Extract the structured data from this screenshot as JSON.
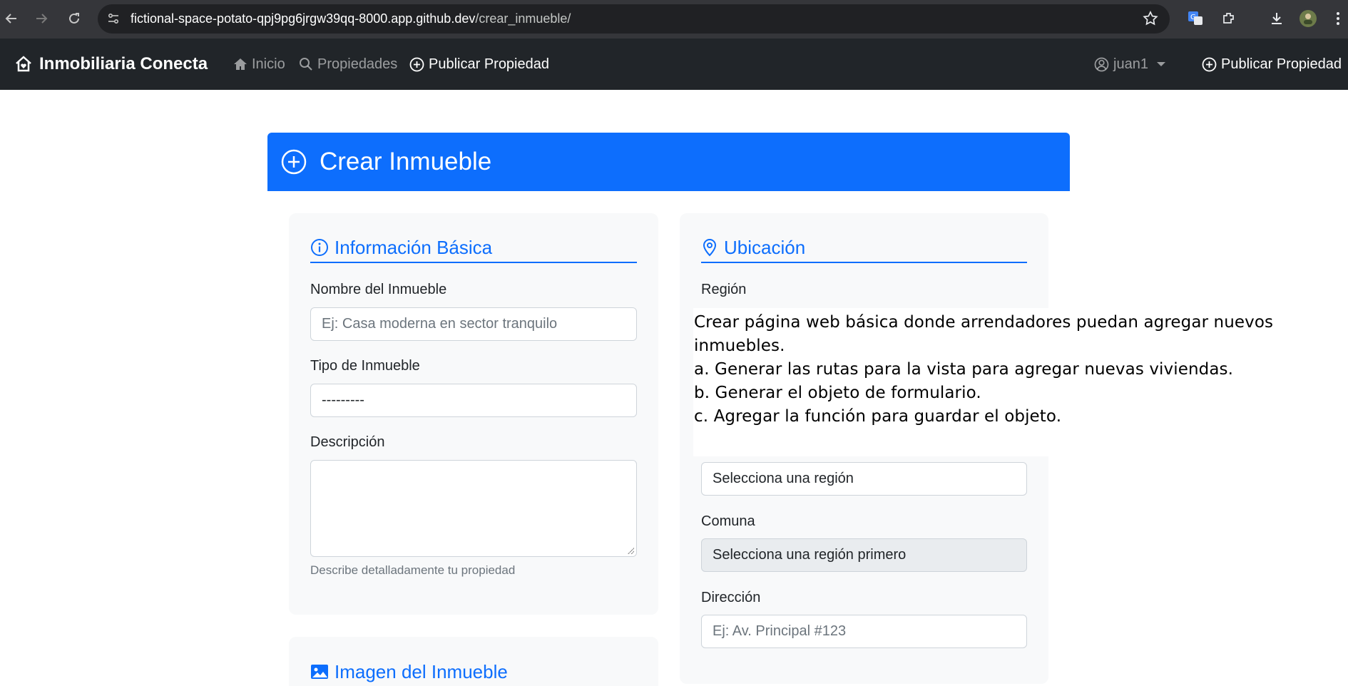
{
  "browser": {
    "url_host": "fictional-space-potato-qpj9pg6jrgw39qq-8000.app.github.dev",
    "url_path": "/crear_inmueble/"
  },
  "navbar": {
    "brand": "Inmobiliaria Conecta",
    "links": [
      {
        "label": "Inicio",
        "icon": "house-icon"
      },
      {
        "label": "Propiedades",
        "icon": "search-icon"
      },
      {
        "label": "Publicar Propiedad",
        "icon": "plus-circle-icon"
      }
    ],
    "user": "juan1",
    "right_link": "Publicar Propiedad"
  },
  "page": {
    "title": "Crear Inmueble",
    "title_icon": "plus-circle-icon"
  },
  "basic_info": {
    "title": "Información Básica",
    "name_label": "Nombre del Inmueble",
    "name_placeholder": "Ej: Casa moderna en sector tranquilo",
    "type_label": "Tipo de Inmueble",
    "type_value": "---------",
    "description_label": "Descripción",
    "description_help": "Describe detalladamente tu propiedad"
  },
  "image_section": {
    "title": "Imagen del Inmueble"
  },
  "location": {
    "title": "Ubicación",
    "region_label": "Región",
    "region_value": "Selecciona una región",
    "comuna_label": "Comuna",
    "comuna_value": "Selecciona una región primero",
    "address_label": "Dirección",
    "address_placeholder": "Ej: Av. Principal #123"
  },
  "overlay_note": {
    "lines": [
      "Crear página web básica donde arrendadores puedan agregar nuevos",
      "inmuebles.",
      "a. Generar las rutas para la vista para agregar nuevas viviendas.",
      "b. Generar el objeto de formulario.",
      "c. Agregar la función para guardar el objeto."
    ]
  },
  "colors": {
    "primary": "#0d6efd",
    "navbar_bg": "#212529",
    "card_bg": "#f8f9fa"
  }
}
